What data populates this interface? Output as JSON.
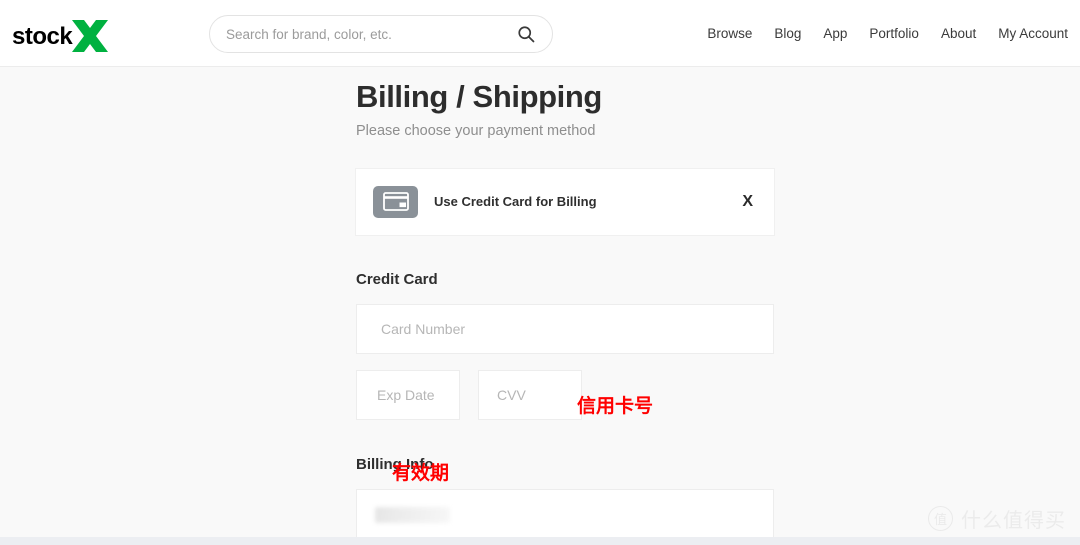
{
  "brand": {
    "name": "stockX",
    "word": "stock",
    "mark": "X",
    "mark_color": "#00b140",
    "word_color": "#000000"
  },
  "header": {
    "search": {
      "placeholder": "Search for brand, color, etc.",
      "value": "",
      "icon": "search-icon"
    },
    "nav": [
      {
        "label": "Browse"
      },
      {
        "label": "Blog"
      },
      {
        "label": "App"
      },
      {
        "label": "Portfolio"
      },
      {
        "label": "About"
      },
      {
        "label": "My Account"
      }
    ]
  },
  "main": {
    "title": "Billing / Shipping",
    "subtitle": "Please choose your payment method",
    "payment_method": {
      "icon": "credit-card-icon",
      "label": "Use Credit Card for Billing",
      "close_label": "X"
    },
    "credit_card": {
      "section_title": "Credit Card",
      "card_number": {
        "placeholder": "Card Number",
        "value": ""
      },
      "expiration": {
        "placeholder": "Exp Date",
        "value": ""
      },
      "cvv": {
        "placeholder": "CVV",
        "value": ""
      }
    },
    "billing_info": {
      "section_title": "Billing Info",
      "first_field": {
        "placeholder": "",
        "value": "",
        "redacted": true
      }
    }
  },
  "annotations": [
    {
      "text": "信用卡号",
      "target": "card-number-field",
      "color": "#ff0000"
    },
    {
      "text": "有效期",
      "target": "expiration-field",
      "color": "#ff0000"
    }
  ],
  "watermark": {
    "badge": "值",
    "text": "什么值得买"
  }
}
